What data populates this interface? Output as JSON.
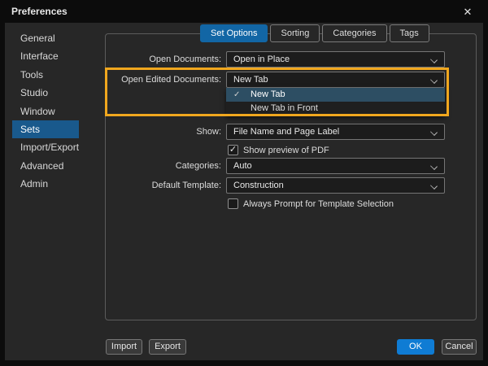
{
  "colors": {
    "titlebar_bg": "#0c0c0c",
    "dialog_bg": "#272727",
    "tab_selected_blue": "#1266a5",
    "sidebar_selected_blue": "#19598c",
    "ok_button_blue": "#0f7cd4",
    "highlight_orange": "#f0a71e",
    "dropdown_selected_bg": "#2d4e63"
  },
  "window": {
    "title": "Preferences",
    "close_glyph": "✕"
  },
  "glyphs": {
    "check": "✓"
  },
  "sidebar": {
    "selected": "Sets",
    "items": [
      {
        "label": "General"
      },
      {
        "label": "Interface"
      },
      {
        "label": "Tools"
      },
      {
        "label": "Studio"
      },
      {
        "label": "Window"
      },
      {
        "label": "Sets"
      },
      {
        "label": "Import/Export"
      },
      {
        "label": "Advanced"
      },
      {
        "label": "Admin"
      }
    ]
  },
  "tabs": [
    {
      "label": "Set Options",
      "selected": true
    },
    {
      "label": "Sorting",
      "selected": false
    },
    {
      "label": "Categories",
      "selected": false
    },
    {
      "label": "Tags",
      "selected": false
    }
  ],
  "form": {
    "open_documents": {
      "label": "Open Documents:",
      "value": "Open in Place"
    },
    "open_edited_documents": {
      "label": "Open Edited Documents:",
      "value": "New Tab",
      "dropdown_open": true,
      "options": [
        {
          "label": "New Tab",
          "checked": true
        },
        {
          "label": "New Tab in Front",
          "checked": false
        }
      ]
    },
    "show": {
      "label": "Show:",
      "value": "File Name and Page Label"
    },
    "show_preview": {
      "label": "Show preview of PDF",
      "checked": true
    },
    "categories": {
      "label": "Categories:",
      "value": "Auto"
    },
    "default_template": {
      "label": "Default Template:",
      "value": "Construction"
    },
    "always_prompt": {
      "label": "Always Prompt for Template Selection",
      "checked": false
    }
  },
  "buttons": {
    "import": "Import",
    "export": "Export",
    "ok": "OK",
    "cancel": "Cancel"
  }
}
